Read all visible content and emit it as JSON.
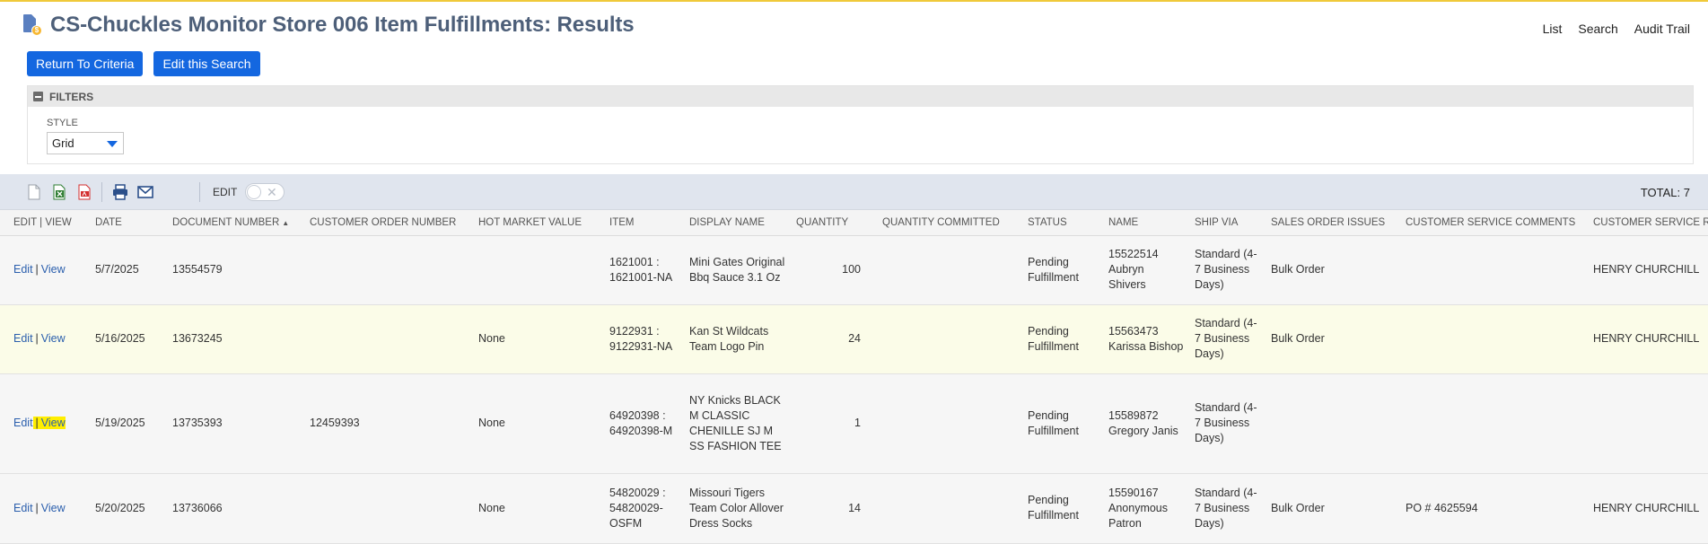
{
  "page": {
    "title": "CS-Chuckles Monitor Store 006 Item Fulfillments: Results",
    "top_links": [
      "List",
      "Search",
      "Audit Trail"
    ]
  },
  "buttons": {
    "return_to_criteria": "Return To Criteria",
    "edit_this_search": "Edit this Search"
  },
  "filters": {
    "heading": "FILTERS",
    "style_label": "STYLE",
    "style_value": "Grid"
  },
  "toolbar": {
    "icons": [
      "new-document-icon",
      "export-excel-icon",
      "export-pdf-icon",
      "print-icon",
      "email-icon"
    ],
    "edit_label": "EDIT",
    "edit_toggle": "off",
    "total": "TOTAL: 7"
  },
  "table": {
    "columns": [
      "EDIT | VIEW",
      "DATE",
      "DOCUMENT NUMBER",
      "CUSTOMER ORDER NUMBER",
      "HOT MARKET VALUE",
      "ITEM",
      "DISPLAY NAME",
      "QUANTITY",
      "QUANTITY COMMITTED",
      "STATUS",
      "NAME",
      "SHIP VIA",
      "SALES ORDER ISSUES",
      "CUSTOMER SERVICE COMMENTS",
      "CUSTOMER SERVICE REP"
    ],
    "sorted_column": "DOCUMENT NUMBER",
    "edit_text": "Edit",
    "view_text": "View",
    "pipe": "|",
    "rows": [
      {
        "date": "5/7/2025",
        "document_number": "13554579",
        "customer_order_number": "",
        "hot_market_value": "",
        "item": "1621001 : 1621001-NA",
        "display_name": "Mini Gates Original Bbq Sauce 3.1 Oz",
        "quantity": "100",
        "quantity_committed": "",
        "status": "Pending Fulfillment",
        "name": "15522514 Aubryn Shivers",
        "ship_via": "Standard (4-7 Business Days)",
        "sales_order_issues": "Bulk Order",
        "customer_service_comments": "",
        "customer_service_rep": "HENRY CHURCHILL"
      },
      {
        "date": "5/16/2025",
        "document_number": "13673245",
        "customer_order_number": "",
        "hot_market_value": "None",
        "item": "9122931 : 9122931-NA",
        "display_name": "Kan St Wildcats Team Logo Pin",
        "quantity": "24",
        "quantity_committed": "",
        "status": "Pending Fulfillment",
        "name": "15563473 Karissa Bishop",
        "ship_via": "Standard (4-7 Business Days)",
        "sales_order_issues": "Bulk Order",
        "customer_service_comments": "",
        "customer_service_rep": "HENRY CHURCHILL"
      },
      {
        "date": "5/19/2025",
        "document_number": "13735393",
        "customer_order_number": "12459393",
        "hot_market_value": "None",
        "item": "64920398 : 64920398-M",
        "display_name": "NY Knicks BLACK M CLASSIC CHENILLE SJ M SS FASHION TEE",
        "quantity": "1",
        "quantity_committed": "",
        "status": "Pending Fulfillment",
        "name": "15589872 Gregory Janis",
        "ship_via": "Standard (4-7 Business Days)",
        "sales_order_issues": "",
        "customer_service_comments": "",
        "customer_service_rep": ""
      },
      {
        "date": "5/20/2025",
        "document_number": "13736066",
        "customer_order_number": "",
        "hot_market_value": "None",
        "item": "54820029 : 54820029-OSFM",
        "display_name": "Missouri Tigers Team Color Allover Dress Socks",
        "quantity": "14",
        "quantity_committed": "",
        "status": "Pending Fulfillment",
        "name": "15590167 Anonymous Patron",
        "ship_via": "Standard (4-7 Business Days)",
        "sales_order_issues": "Bulk Order",
        "customer_service_comments": "PO # 4625594",
        "customer_service_rep": "HENRY CHURCHILL"
      }
    ]
  },
  "colors": {
    "title": "#4d5f79",
    "primary_button": "#1467e0",
    "link": "#2b5fad",
    "toolbar_bg": "#e0e5ee",
    "row_highlight": "#fbfce8",
    "text_highlight": "#ffee00"
  }
}
